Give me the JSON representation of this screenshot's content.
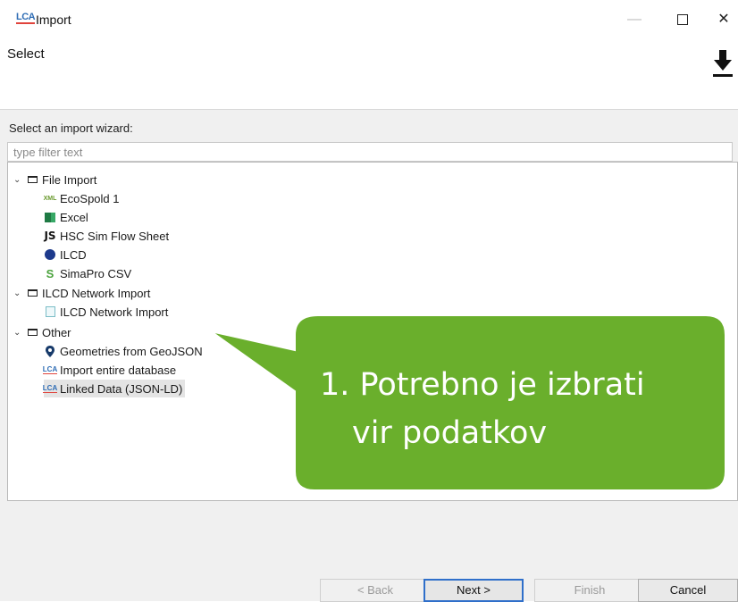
{
  "window": {
    "app_icon": "LCA",
    "title": "Import",
    "minimize": "—",
    "close": "✕"
  },
  "header": {
    "title": "Select",
    "icon": "download-icon"
  },
  "main": {
    "prompt": "Select an import wizard:",
    "filter_placeholder": "type filter text"
  },
  "tree": {
    "groups": [
      {
        "label": "File Import",
        "items": [
          {
            "label": "EcoSpold 1",
            "icon": "xml-icon",
            "icon_text": "XML"
          },
          {
            "label": "Excel",
            "icon": "excel-icon"
          },
          {
            "label": "HSC Sim Flow Sheet",
            "icon": "js-icon",
            "icon_text": "JS"
          },
          {
            "label": "ILCD",
            "icon": "ilcd-icon"
          },
          {
            "label": "SimaPro CSV",
            "icon": "simapro-icon",
            "icon_text": "S"
          }
        ]
      },
      {
        "label": "ILCD Network Import",
        "items": [
          {
            "label": "ILCD Network Import",
            "icon": "network-icon"
          }
        ]
      },
      {
        "label": "Other",
        "items": [
          {
            "label": "Geometries from GeoJSON",
            "icon": "map-pin-icon",
            "icon_text": "⬤"
          },
          {
            "label": "Import entire database",
            "icon": "lca-icon",
            "icon_text": "LCA"
          },
          {
            "label": "Linked Data (JSON-LD)",
            "icon": "lca-icon",
            "icon_text": "LCA",
            "selected": true
          }
        ]
      }
    ]
  },
  "buttons": {
    "back": "< Back",
    "next": "Next >",
    "finish": "Finish",
    "cancel": "Cancel"
  },
  "callout": {
    "line1": "1. Potrebno je izbrati",
    "line2": "vir podatkov",
    "color": "#6aaf2c"
  }
}
